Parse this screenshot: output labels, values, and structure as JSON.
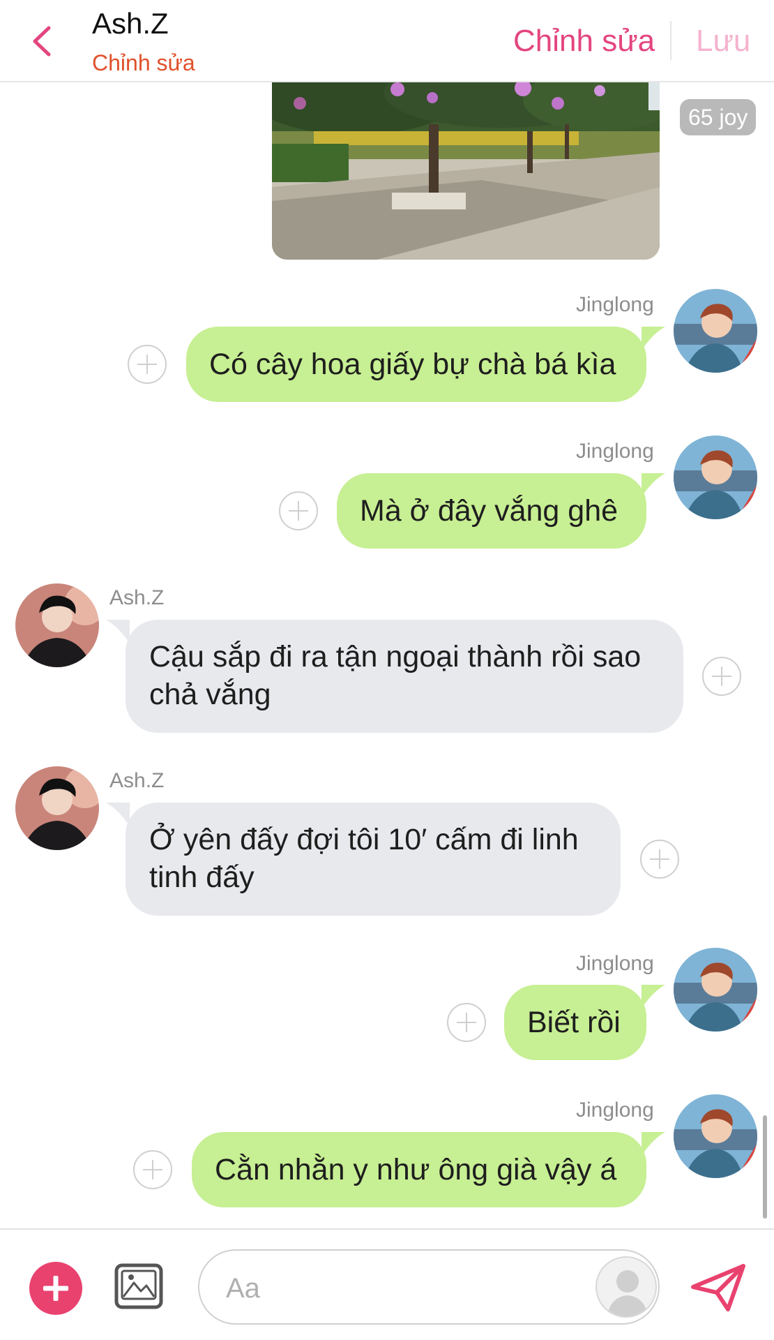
{
  "header": {
    "title": "Ash.Z",
    "subtitle": "Chỉnh sửa",
    "edit_label": "Chỉnh sửa",
    "save_label": "Lưu"
  },
  "photo_message": {
    "badge": "65 joy"
  },
  "messages": [
    {
      "sender": "Jinglong",
      "text": "Có cây hoa giấy bự chà bá kìa",
      "direction": "out"
    },
    {
      "sender": "Jinglong",
      "text": "Mà ở đây vắng ghê",
      "direction": "out"
    },
    {
      "sender": "Ash.Z",
      "text": "Cậu sắp đi ra tận ngoại thành rồi sao chả vắng",
      "direction": "in"
    },
    {
      "sender": "Ash.Z",
      "text": "Ở yên đấy đợi tôi 10′ cấm đi linh tinh đấy",
      "direction": "in"
    },
    {
      "sender": "Jinglong",
      "text": "Biết rồi",
      "direction": "out"
    },
    {
      "sender": "Jinglong",
      "text": "Cằn nhằn y như ông già vậy á",
      "direction": "out"
    }
  ],
  "composer": {
    "placeholder": "Aa"
  },
  "colors": {
    "accent": "#e9426f",
    "outgoing_bubble": "#c7ef93",
    "incoming_bubble": "#e8e9ed"
  },
  "icons": {
    "back": "chevron-left-icon",
    "add": "plus-circle-icon",
    "image": "image-icon",
    "sticker": "sticker-icon",
    "send": "send-icon",
    "reaction": "plus-icon"
  }
}
